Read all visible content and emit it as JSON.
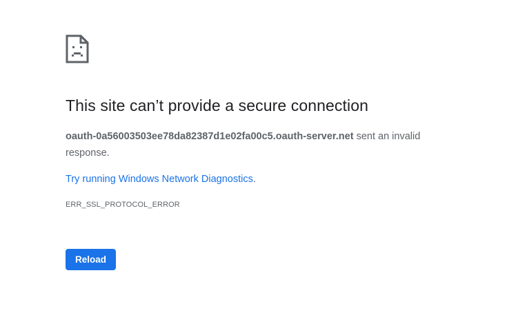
{
  "error": {
    "icon": "sad-document-icon",
    "title": "This site can’t provide a secure connection",
    "host": "oauth-0a56003503ee78da82387d1e02fa00c5.oauth-server.net",
    "message_suffix": " sent an invalid response.",
    "diagnostics_link": "Try running Windows Network Diagnostics",
    "diagnostics_period": ".",
    "code": "ERR_SSL_PROTOCOL_ERROR",
    "reload_label": "Reload"
  },
  "colors": {
    "accent": "#1a73e8",
    "text_primary": "#202124",
    "text_secondary": "#5f6368",
    "background": "#ffffff"
  }
}
